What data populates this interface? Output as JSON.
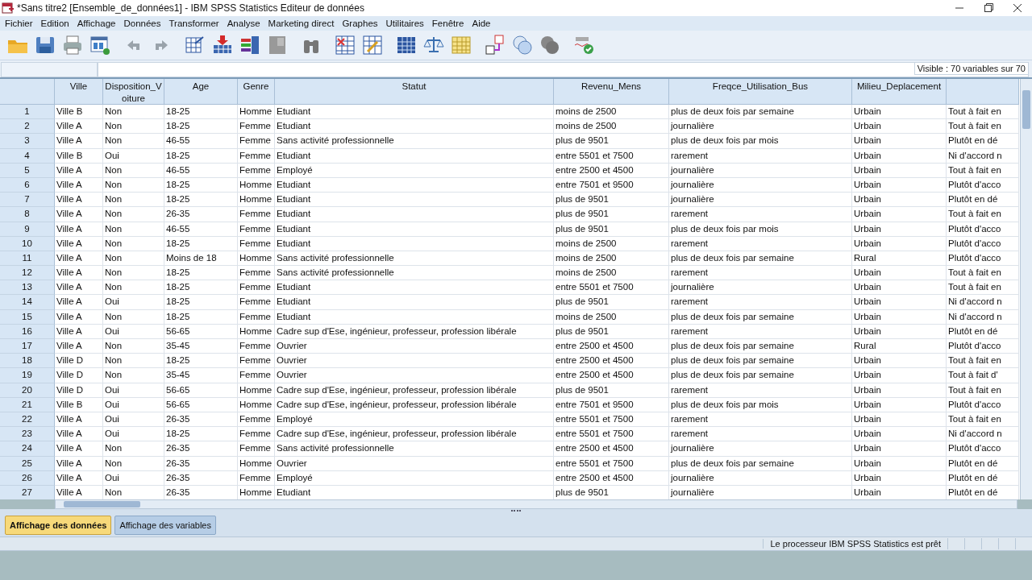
{
  "window": {
    "title": "*Sans titre2 [Ensemble_de_données1] - IBM SPSS Statistics Editeur de données"
  },
  "menu": [
    "Fichier",
    "Edition",
    "Affichage",
    "Données",
    "Transformer",
    "Analyse",
    "Marketing direct",
    "Graphes",
    "Utilitaires",
    "Fenêtre",
    "Aide"
  ],
  "visible_info": "Visible : 70 variables sur 70",
  "table": {
    "columns": [
      "Ville",
      "Disposition_Voiture",
      "Age",
      "Genre",
      "Statut",
      "Revenu_Mens",
      "Freqce_Utilisation_Bus",
      "Milieu_Deplacement"
    ],
    "rows": [
      {
        "number": "1",
        "cells": [
          "Ville B",
          "Non",
          "18-25",
          "Homme",
          "Etudiant",
          "moins de 2500",
          "plus de deux fois par semaine",
          "Urbain",
          "Tout à fait en"
        ]
      },
      {
        "number": "2",
        "cells": [
          "Ville A",
          "Non",
          "18-25",
          "Femme",
          "Etudiant",
          "moins de 2500",
          "journalière",
          "Urbain",
          "Tout à fait en"
        ]
      },
      {
        "number": "3",
        "cells": [
          "Ville A",
          "Non",
          "46-55",
          "Femme",
          "Sans activité professionnelle",
          "plus de 9501",
          "plus de deux fois par mois",
          "Urbain",
          "Plutôt en dé"
        ]
      },
      {
        "number": "4",
        "cells": [
          "Ville B",
          "Oui",
          "18-25",
          "Femme",
          "Etudiant",
          "entre 5501 et 7500",
          "rarement",
          "Urbain",
          "Ni d'accord n"
        ]
      },
      {
        "number": "5",
        "cells": [
          "Ville A",
          "Non",
          "46-55",
          "Femme",
          "Employé",
          "entre 2500 et 4500",
          "journalière",
          "Urbain",
          "Tout à fait en"
        ]
      },
      {
        "number": "6",
        "cells": [
          "Ville A",
          "Non",
          "18-25",
          "Homme",
          "Etudiant",
          "entre 7501 et 9500",
          "journalière",
          "Urbain",
          "Plutôt d'acco"
        ]
      },
      {
        "number": "7",
        "cells": [
          "Ville A",
          "Non",
          "18-25",
          "Homme",
          "Etudiant",
          "plus de 9501",
          "journalière",
          "Urbain",
          "Plutôt en dé"
        ]
      },
      {
        "number": "8",
        "cells": [
          "Ville A",
          "Non",
          "26-35",
          "Femme",
          "Etudiant",
          "plus de 9501",
          "rarement",
          "Urbain",
          "Tout à fait en"
        ]
      },
      {
        "number": "9",
        "cells": [
          "Ville A",
          "Non",
          "46-55",
          "Femme",
          "Etudiant",
          "plus de 9501",
          "plus de deux fois par mois",
          "Urbain",
          "Plutôt d'acco"
        ]
      },
      {
        "number": "10",
        "cells": [
          "Ville A",
          "Non",
          "18-25",
          "Femme",
          "Etudiant",
          "moins de 2500",
          "rarement",
          "Urbain",
          "Plutôt d'acco"
        ]
      },
      {
        "number": "11",
        "cells": [
          "Ville A",
          "Non",
          "Moins de 18",
          "Homme",
          "Sans activité professionnelle",
          "moins de 2500",
          "plus de deux fois par semaine",
          "Rural",
          "Plutôt d'acco"
        ]
      },
      {
        "number": "12",
        "cells": [
          "Ville A",
          "Non",
          "18-25",
          "Femme",
          "Sans activité professionnelle",
          "moins de 2500",
          "rarement",
          "Urbain",
          "Tout à fait en"
        ]
      },
      {
        "number": "13",
        "cells": [
          "Ville A",
          "Non",
          "18-25",
          "Femme",
          "Etudiant",
          "entre 5501 et 7500",
          "journalière",
          "Urbain",
          "Tout à fait en"
        ]
      },
      {
        "number": "14",
        "cells": [
          "Ville A",
          "Oui",
          "18-25",
          "Femme",
          "Etudiant",
          "plus de 9501",
          "rarement",
          "Urbain",
          "Ni d'accord n"
        ]
      },
      {
        "number": "15",
        "cells": [
          "Ville A",
          "Non",
          "18-25",
          "Femme",
          "Etudiant",
          "moins de 2500",
          "plus de deux fois par semaine",
          "Urbain",
          "Ni d'accord n"
        ]
      },
      {
        "number": "16",
        "cells": [
          "Ville A",
          "Oui",
          "56-65",
          "Homme",
          "Cadre sup d'Ese, ingénieur, professeur, profession libérale",
          "plus de 9501",
          "rarement",
          "Urbain",
          "Plutôt en dé"
        ]
      },
      {
        "number": "17",
        "cells": [
          "Ville A",
          "Non",
          "35-45",
          "Femme",
          "Ouvrier",
          "entre 2500 et 4500",
          "plus de deux fois par semaine",
          "Rural",
          "Plutôt d'acco"
        ]
      },
      {
        "number": "18",
        "cells": [
          "Ville D",
          "Non",
          "18-25",
          "Femme",
          "Ouvrier",
          "entre 2500 et 4500",
          "plus de deux fois par semaine",
          "Urbain",
          "Tout à fait en"
        ]
      },
      {
        "number": "19",
        "cells": [
          "Ville D",
          "Non",
          "35-45",
          "Femme",
          "Ouvrier",
          "entre 2500 et 4500",
          "plus de deux fois par semaine",
          "Urbain",
          "Tout à fait d'"
        ]
      },
      {
        "number": "20",
        "cells": [
          "Ville D",
          "Oui",
          "56-65",
          "Homme",
          "Cadre sup d'Ese, ingénieur, professeur, profession libérale",
          "plus de 9501",
          "rarement",
          "Urbain",
          "Tout à fait en"
        ]
      },
      {
        "number": "21",
        "cells": [
          "Ville B",
          "Oui",
          "56-65",
          "Homme",
          "Cadre sup d'Ese, ingénieur, professeur, profession libérale",
          "entre 7501 et 9500",
          "plus de deux fois par mois",
          "Urbain",
          "Plutôt d'acco"
        ]
      },
      {
        "number": "22",
        "cells": [
          "Ville A",
          "Oui",
          "26-35",
          "Femme",
          "Employé",
          "entre 5501 et 7500",
          "rarement",
          "Urbain",
          "Tout à fait en"
        ]
      },
      {
        "number": "23",
        "cells": [
          "Ville A",
          "Oui",
          "18-25",
          "Femme",
          "Cadre sup d'Ese, ingénieur, professeur, profession libérale",
          "entre 5501 et 7500",
          "rarement",
          "Urbain",
          "Ni d'accord n"
        ]
      },
      {
        "number": "24",
        "cells": [
          "Ville A",
          "Non",
          "26-35",
          "Femme",
          "Sans activité professionnelle",
          "entre 2500 et 4500",
          "journalière",
          "Urbain",
          "Plutôt d'acco"
        ]
      },
      {
        "number": "25",
        "cells": [
          "Ville A",
          "Non",
          "26-35",
          "Homme",
          "Ouvrier",
          "entre 5501 et 7500",
          "plus de deux fois par semaine",
          "Urbain",
          "Plutôt en dé"
        ]
      },
      {
        "number": "26",
        "cells": [
          "Ville A",
          "Oui",
          "26-35",
          "Femme",
          "Employé",
          "entre 2500 et 4500",
          "journalière",
          "Urbain",
          "Plutôt en dé"
        ]
      },
      {
        "number": "27",
        "cells": [
          "Ville A",
          "Non",
          "26-35",
          "Homme",
          "Etudiant",
          "plus de 9501",
          "journalière",
          "Urbain",
          "Plutôt en dé"
        ]
      }
    ]
  },
  "view_tabs": [
    {
      "label": "Affichage des données",
      "selected": true
    },
    {
      "label": "Affichage des variables",
      "selected": false
    }
  ],
  "status_bar": "Le processeur IBM SPSS Statistics  est prêt"
}
